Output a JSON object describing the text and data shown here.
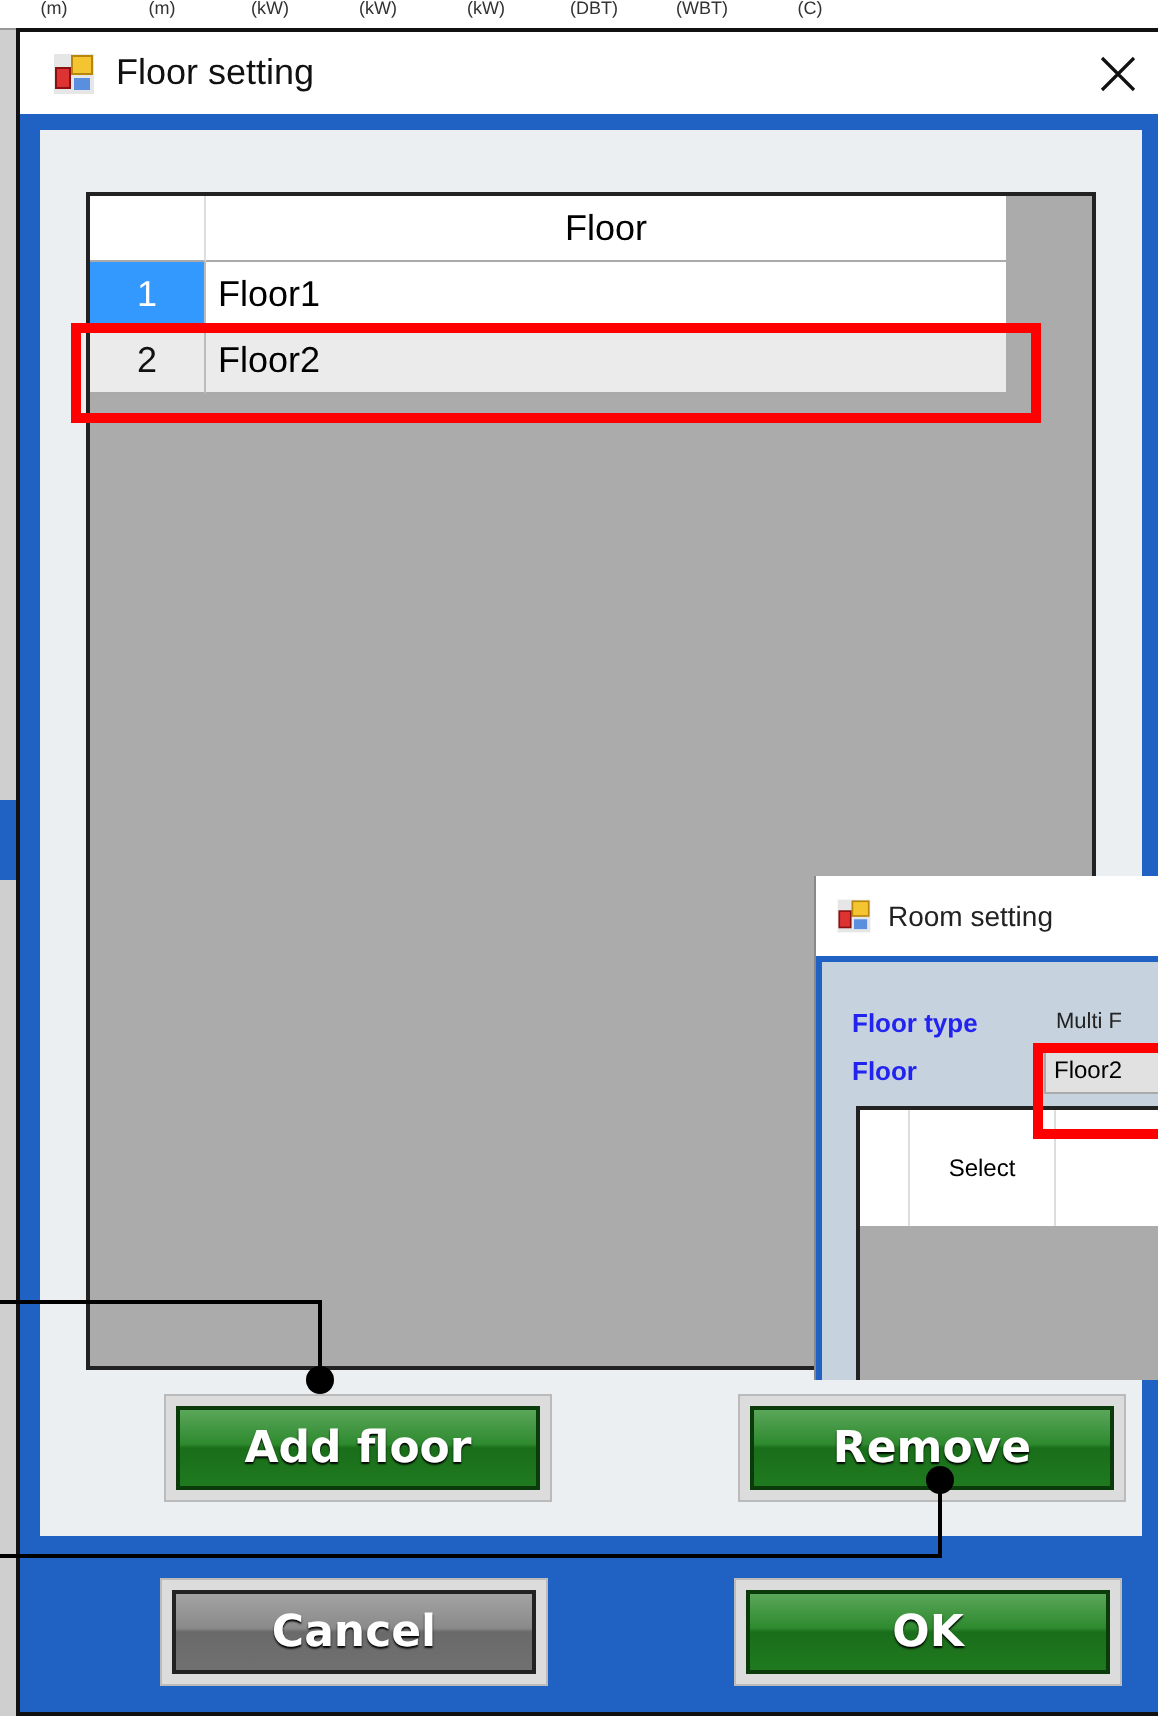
{
  "background_table": {
    "units": [
      "(m)",
      "(m)",
      "(kW)",
      "(kW)",
      "(kW)",
      "(DBT)",
      "(WBT)",
      "(C)"
    ]
  },
  "window": {
    "title": "Floor setting"
  },
  "table": {
    "column": "Floor",
    "rows": [
      {
        "number": "1",
        "name": "Floor1",
        "selected": true
      },
      {
        "number": "2",
        "name": "Floor2",
        "selected": false
      }
    ]
  },
  "panel_buttons": [
    {
      "label": "Add floor",
      "kind": "green"
    },
    {
      "label": "Remove",
      "kind": "green"
    }
  ],
  "footer_buttons": [
    {
      "label": "Cancel",
      "kind": "gray"
    },
    {
      "label": "OK",
      "kind": "green"
    }
  ],
  "room_window": {
    "title": "Room setting",
    "floor_type_label": "Floor type",
    "floor_type_value": "Multi F",
    "floor_label": "Floor",
    "floor_value": "Floor2",
    "column": "Select"
  }
}
